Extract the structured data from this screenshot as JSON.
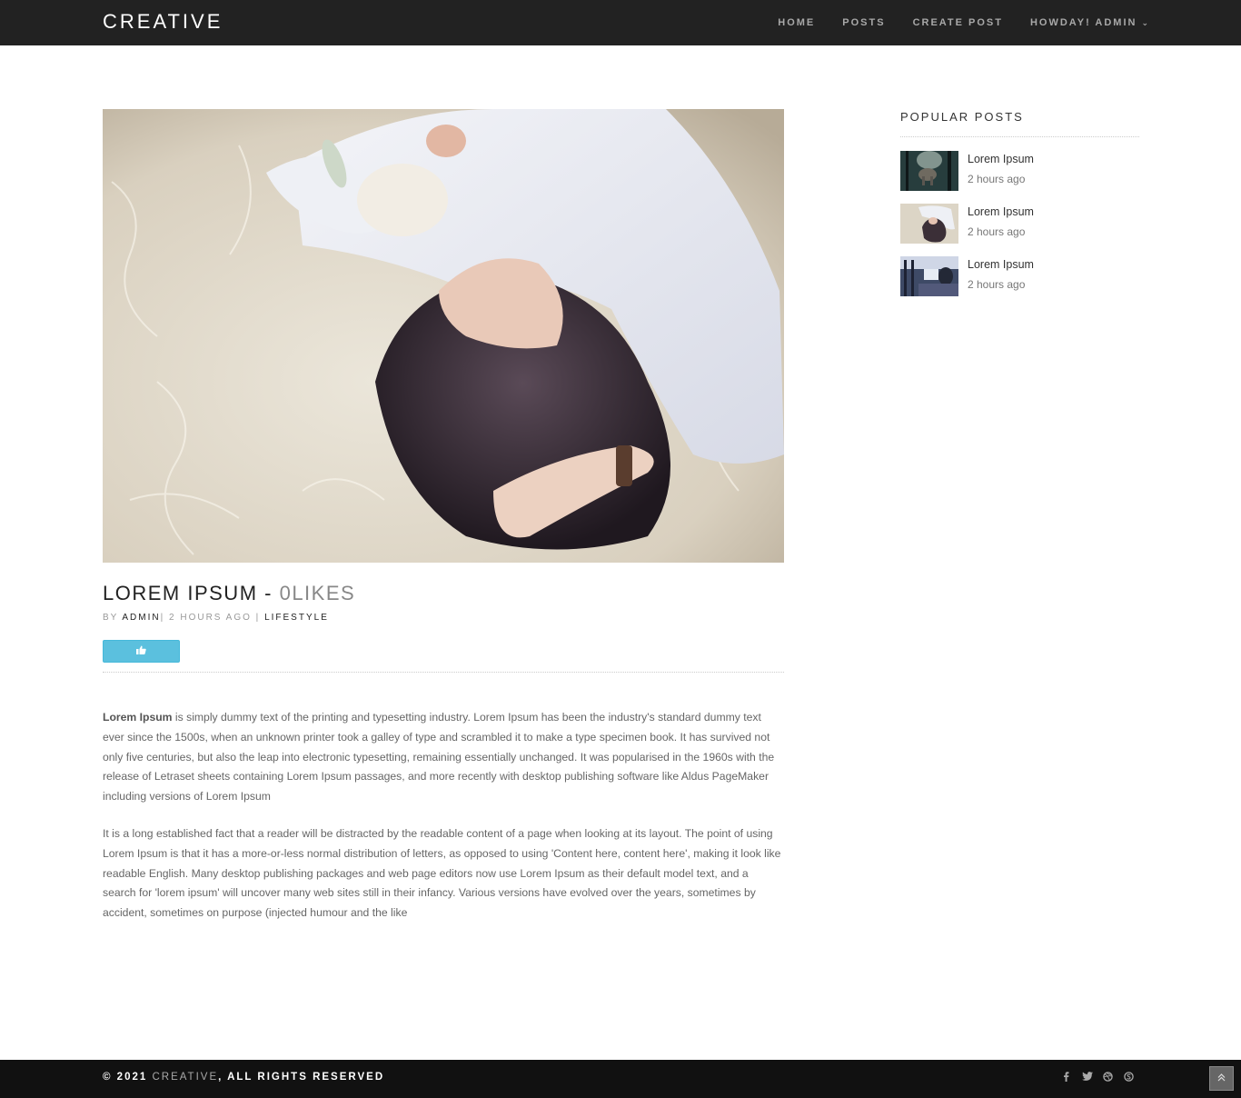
{
  "header": {
    "brand": "CREATIVE",
    "nav": [
      {
        "label": "HOME"
      },
      {
        "label": "POSTS"
      },
      {
        "label": "CREATE POST"
      },
      {
        "label": "HOWDAY! ADMIN",
        "has_dropdown": true
      }
    ]
  },
  "post": {
    "title": "LOREM IPSUM - ",
    "likes": "0LIKES",
    "meta": {
      "by": "BY ",
      "author": "ADMIN",
      "time": "| 2 HOURS AGO | ",
      "category": "LIFESTYLE"
    },
    "like_icon": "thumbs-up-icon",
    "body": {
      "p1_lead": "Lorem Ipsum",
      "p1_rest": " is simply dummy text of the printing and typesetting industry. Lorem Ipsum has been the industry's standard dummy text ever since the 1500s, when an unknown printer took a galley of type and scrambled it to make a type specimen book. It has survived not only five centuries, but also the leap into electronic typesetting, remaining essentially unchanged. It was popularised in the 1960s with the release of Letraset sheets containing Lorem Ipsum passages, and more recently with desktop publishing software like Aldus PageMaker including versions of Lorem Ipsum",
      "p2": "It is a long established fact that a reader will be distracted by the readable content of a page when looking at its layout. The point of using Lorem Ipsum is that it has a more-or-less normal distribution of letters, as opposed to using 'Content here, content here', making it look like readable English. Many desktop publishing packages and web page editors now use Lorem Ipsum as their default model text, and a search for 'lorem ipsum' will uncover many web sites still in their infancy. Various versions have evolved over the years, sometimes by accident, sometimes on purpose (injected humour and the like"
    }
  },
  "sidebar": {
    "title": "POPULAR POSTS",
    "posts": [
      {
        "title": "Lorem Ipsum",
        "time": "2 hours ago"
      },
      {
        "title": "Lorem Ipsum",
        "time": "2 hours ago"
      },
      {
        "title": "Lorem Ipsum",
        "time": "2 hours ago"
      }
    ]
  },
  "footer": {
    "copyright_prefix": "© 2021 ",
    "brand": "CREATIVE",
    "copyright_suffix": ", ALL RIGHTS RESERVED",
    "social": [
      "facebook-icon",
      "twitter-icon",
      "dribbble-icon",
      "skype-icon"
    ]
  },
  "colors": {
    "navbar_bg": "#222222",
    "footer_bg": "#111111",
    "like_button": "#5bc0de"
  }
}
